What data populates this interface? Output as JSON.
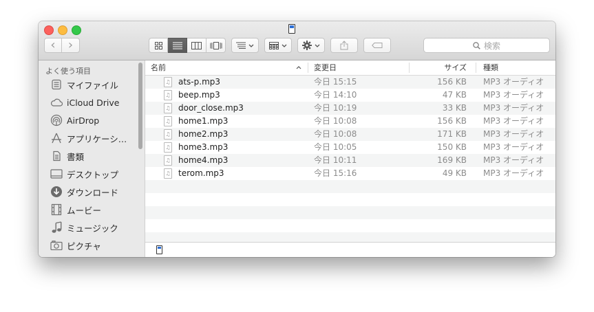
{
  "toolbar": {
    "back_glyph": "‹",
    "forward_glyph": "›",
    "view_icons": [
      "icon-view-icon",
      "list-view-icon",
      "column-view-icon",
      "coverflow-view-icon"
    ],
    "arrange_icon": "arrange-icon",
    "group_icon": "group-icon",
    "action_icon": "gear-icon",
    "share_icon": "share-icon",
    "tag_icon": "tag-icon",
    "search_placeholder": "検索"
  },
  "sidebar": {
    "heading": "よく使う項目",
    "items": [
      {
        "label": "マイファイル",
        "icon": "all-my-files-icon"
      },
      {
        "label": "iCloud Drive",
        "icon": "cloud-icon"
      },
      {
        "label": "AirDrop",
        "icon": "airdrop-icon"
      },
      {
        "label": "アプリケーシ…",
        "icon": "applications-icon"
      },
      {
        "label": "書類",
        "icon": "documents-icon"
      },
      {
        "label": "デスクトップ",
        "icon": "desktop-icon"
      },
      {
        "label": "ダウンロード",
        "icon": "downloads-icon"
      },
      {
        "label": "ムービー",
        "icon": "movies-icon"
      },
      {
        "label": "ミュージック",
        "icon": "music-icon"
      },
      {
        "label": "ピクチャ",
        "icon": "pictures-icon"
      }
    ]
  },
  "columns": {
    "name": "名前",
    "date": "変更日",
    "size": "サイズ",
    "kind": "種類"
  },
  "files": [
    {
      "name": "ats-p.mp3",
      "date": "今日 15:15",
      "size": "156 KB",
      "kind": "MP3 オーディオ"
    },
    {
      "name": "beep.mp3",
      "date": "今日 14:10",
      "size": "47 KB",
      "kind": "MP3 オーディオ"
    },
    {
      "name": "door_close.mp3",
      "date": "今日 10:19",
      "size": "33 KB",
      "kind": "MP3 オーディオ"
    },
    {
      "name": "home1.mp3",
      "date": "今日 10:08",
      "size": "156 KB",
      "kind": "MP3 オーディオ"
    },
    {
      "name": "home2.mp3",
      "date": "今日 10:08",
      "size": "171 KB",
      "kind": "MP3 オーディオ"
    },
    {
      "name": "home3.mp3",
      "date": "今日 10:05",
      "size": "150 KB",
      "kind": "MP3 オーディオ"
    },
    {
      "name": "home4.mp3",
      "date": "今日 10:11",
      "size": "169 KB",
      "kind": "MP3 オーディオ"
    },
    {
      "name": "terom.mp3",
      "date": "今日 15:16",
      "size": "49 KB",
      "kind": "MP3 オーディオ"
    }
  ],
  "colors": {
    "close": "#fc615d",
    "minimize": "#fdbc40",
    "zoom": "#34c84a",
    "volume_accent": "#2c6fd6"
  }
}
